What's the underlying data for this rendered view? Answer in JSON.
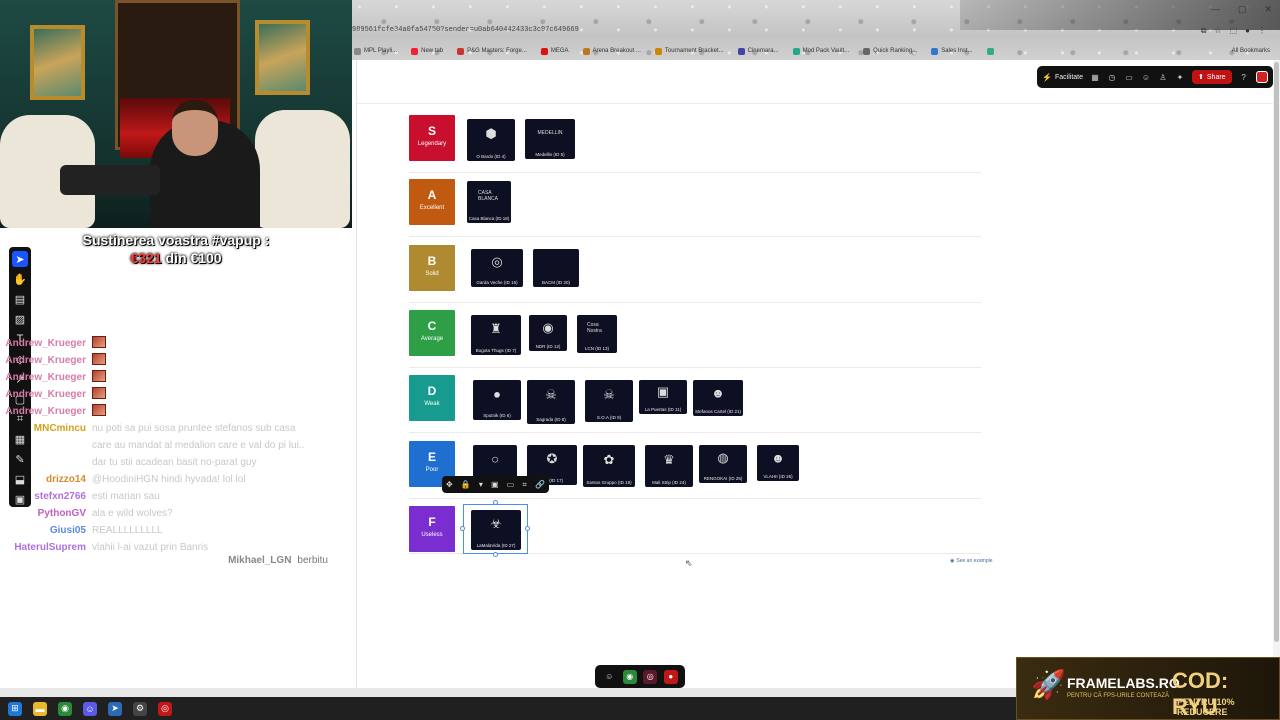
{
  "stream": {
    "support_line": "Sustinerea voastra #vapup :",
    "support_raised": "€321",
    "support_mid": " din ",
    "support_goal": "€100"
  },
  "chat": [
    {
      "user": "Andrew_Krueger",
      "color": "#d97ba8",
      "msg": "",
      "emote": true
    },
    {
      "user": "Andrew_Krueger",
      "color": "#d97ba8",
      "msg": "",
      "emote": true
    },
    {
      "user": "Andrew_Krueger",
      "color": "#d97ba8",
      "msg": "",
      "emote": true
    },
    {
      "user": "Andrew_Krueger",
      "color": "#d97ba8",
      "msg": "",
      "emote": true
    },
    {
      "user": "Andrew_Krueger",
      "color": "#d97ba8",
      "msg": "",
      "emote": true
    },
    {
      "user": "MNCmincu",
      "color": "#d4a017",
      "msg": "nu poti sa pui sosa pruntee stefanos sub casa"
    },
    {
      "user": "",
      "color": "#d4a017",
      "msg": "care au mandat al medalion care e val do pi lui.."
    },
    {
      "user": "",
      "color": "#d4a017",
      "msg": "dar tu stii acadean basit no-parat guy"
    },
    {
      "user": "drizzo14",
      "color": "#d98b2b",
      "msg": "@HoodiniHGN hindi hyvada! lol lol"
    },
    {
      "user": "stefxn2766",
      "color": "#b070e0",
      "msg": "esti marian sau"
    },
    {
      "user": "PythonGV",
      "color": "#c060c0",
      "msg": "ala e wild wolves?"
    },
    {
      "user": "Giusi05",
      "color": "#5a8ae8",
      "msg": "REALLLLLLLLL"
    },
    {
      "user": "HaterulSuprem",
      "color": "#b070e0",
      "msg": "vlahii l-ai vazut prin Banris"
    }
  ],
  "chat_last": {
    "user": "Mikhael_LGN",
    "msg": "berbitu"
  },
  "browser": {
    "url": "989561fcfe34a0fa54750?sender=u0ab640442433c3c97c649669",
    "bookmarks": [
      {
        "label": "MPL Playli...",
        "color": "#888"
      },
      {
        "label": "New tab",
        "color": "#e23"
      },
      {
        "label": "P&G Masters: Forge...",
        "color": "#c33"
      },
      {
        "label": "MEGA",
        "color": "#d11"
      },
      {
        "label": "Arena Breakout ...",
        "color": "#b72"
      },
      {
        "label": "Tournament Bracket...",
        "color": "#c80"
      },
      {
        "label": "Cinemara...",
        "color": "#44a"
      },
      {
        "label": "Mod Pack Vault...",
        "color": "#2a8"
      },
      {
        "label": "Quick Ranking...",
        "color": "#666"
      },
      {
        "label": "Sales Inst...",
        "color": "#37c"
      },
      {
        "label": "",
        "color": "#3a8"
      }
    ],
    "all_bookmarks": "All Bookmarks"
  },
  "miro": {
    "facilitate": "Facilitate",
    "share": "Share",
    "help": "?"
  },
  "tiers": [
    {
      "letter": "S",
      "word": "Legendary",
      "color": "#c8102e",
      "cards": [
        {
          "caption": "O Bardo (ID 4)",
          "logo": "⬢"
        },
        {
          "caption": "Medellin (ID 5)",
          "logo": "MEDELLIN"
        }
      ]
    },
    {
      "letter": "A",
      "word": "Excellent",
      "color": "#c05a10",
      "cards": [
        {
          "caption": "Casa Blanca (ID 18)",
          "logo": "CASA BLANCA"
        }
      ]
    },
    {
      "letter": "B",
      "word": "Solid",
      "color": "#b08a30",
      "cards": [
        {
          "caption": "Garda Veche (ID 16)",
          "logo": "◎"
        },
        {
          "caption": "BACM (ID 20)",
          "logo": ""
        }
      ]
    },
    {
      "letter": "C",
      "word": "Average",
      "color": "#2e9e47",
      "cards": [
        {
          "caption": "Bogota Thugs (ID 7)",
          "logo": "♜"
        },
        {
          "caption": "NDR (ID 12)",
          "logo": "◉"
        },
        {
          "caption": "LCN (ID 13)",
          "logo": "Cosa Nostra"
        }
      ]
    },
    {
      "letter": "D",
      "word": "Weak",
      "color": "#169b8e",
      "cards": [
        {
          "caption": "Sputnik (ID 6)",
          "logo": "●"
        },
        {
          "caption": "Sagrada (ID 8)",
          "logo": "☠"
        },
        {
          "caption": "S.O.A (ID 9)",
          "logo": "☠"
        },
        {
          "caption": "La Puertas (ID 11)",
          "logo": "▣"
        },
        {
          "caption": "Stefanos Cartel (ID 21)",
          "logo": "☻"
        }
      ]
    },
    {
      "letter": "E",
      "word": "Poor",
      "color": "#1e6fd0",
      "cards": [
        {
          "caption": "",
          "logo": "○"
        },
        {
          "caption": "MC (ID 17)",
          "logo": "✪"
        },
        {
          "caption": "Santos Gruppo (ID 19)",
          "logo": "✿"
        },
        {
          "caption": "Mali Strip (ID 24)",
          "logo": "♛"
        },
        {
          "caption": "RENGOKAI (ID 25)",
          "logo": "◍"
        },
        {
          "caption": "VLAHII (ID 26)",
          "logo": "☻"
        }
      ]
    },
    {
      "letter": "F",
      "word": "Useless",
      "color": "#7a2ed0",
      "cards": [
        {
          "caption": "LaMalaVida (ID 27)",
          "logo": "☣"
        }
      ]
    }
  ],
  "see_example": "See an example",
  "ad": {
    "brand": "FRAMELABS.RO",
    "sub": "PENTRU CĂ FPS-URILE CONTEAZĂ",
    "code": "COD: RYU",
    "code_sub": "PENTRU 10% REDUCERE"
  }
}
